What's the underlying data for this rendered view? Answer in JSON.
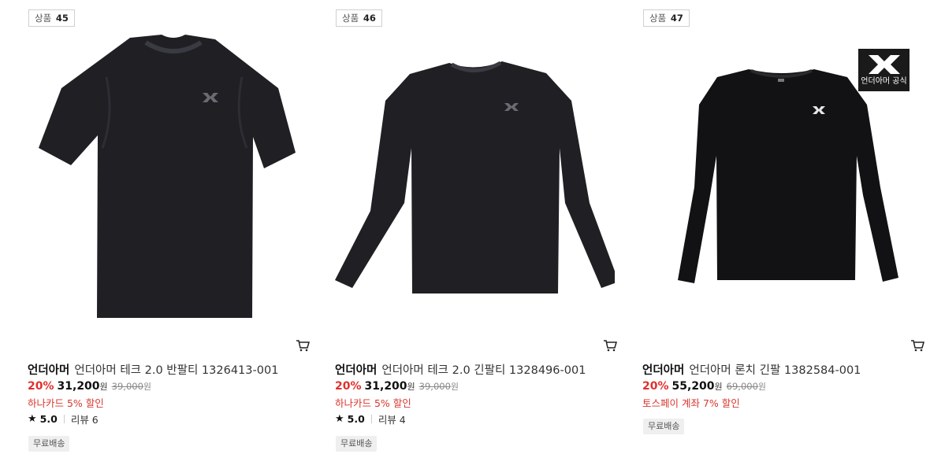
{
  "products": [
    {
      "rank_label": "상품",
      "rank_num": "45",
      "brand": "언더아머",
      "name": "언더아머 테크 2.0 반팔티 1326413-001",
      "discount": "20%",
      "price": "31,200",
      "currency": "원",
      "original_price": "39,000",
      "promo": "하나카드 5% 할인",
      "rating": "5.0",
      "reviews": "리뷰 6",
      "shipping": "무료배송",
      "image": "short-sleeve-tshirt-black"
    },
    {
      "rank_label": "상품",
      "rank_num": "46",
      "brand": "언더아머",
      "name": "언더아머 테크 2.0 긴팔티 1328496-001",
      "discount": "20%",
      "price": "31,200",
      "currency": "원",
      "original_price": "39,000",
      "promo": "하나카드 5% 할인",
      "rating": "5.0",
      "reviews": "리뷰 4",
      "shipping": "무료배송",
      "image": "long-sleeve-tshirt-black"
    },
    {
      "rank_label": "상품",
      "rank_num": "47",
      "brand": "언더아머",
      "name": "언더아머 론치 긴팔 1382584-001",
      "discount": "20%",
      "price": "55,200",
      "currency": "원",
      "original_price": "69,000",
      "promo": "토스페이 계좌 7% 할인",
      "shipping": "무료배송",
      "official_badge": "언더아머 공식",
      "image": "long-sleeve-launch-black"
    }
  ],
  "icons": {
    "cart": "cart-icon",
    "star": "star-icon"
  },
  "colors": {
    "discount": "#e0302d",
    "promo": "#d8372f",
    "shirt": "#1f1f24"
  }
}
